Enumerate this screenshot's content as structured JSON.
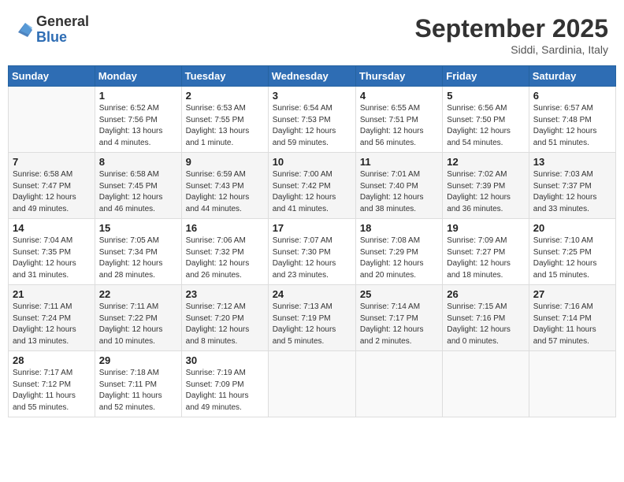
{
  "header": {
    "logo_general": "General",
    "logo_blue": "Blue",
    "month_title": "September 2025",
    "location": "Siddi, Sardinia, Italy"
  },
  "days_of_week": [
    "Sunday",
    "Monday",
    "Tuesday",
    "Wednesday",
    "Thursday",
    "Friday",
    "Saturday"
  ],
  "weeks": [
    [
      {
        "day": "",
        "info": ""
      },
      {
        "day": "1",
        "info": "Sunrise: 6:52 AM\nSunset: 7:56 PM\nDaylight: 13 hours\nand 4 minutes."
      },
      {
        "day": "2",
        "info": "Sunrise: 6:53 AM\nSunset: 7:55 PM\nDaylight: 13 hours\nand 1 minute."
      },
      {
        "day": "3",
        "info": "Sunrise: 6:54 AM\nSunset: 7:53 PM\nDaylight: 12 hours\nand 59 minutes."
      },
      {
        "day": "4",
        "info": "Sunrise: 6:55 AM\nSunset: 7:51 PM\nDaylight: 12 hours\nand 56 minutes."
      },
      {
        "day": "5",
        "info": "Sunrise: 6:56 AM\nSunset: 7:50 PM\nDaylight: 12 hours\nand 54 minutes."
      },
      {
        "day": "6",
        "info": "Sunrise: 6:57 AM\nSunset: 7:48 PM\nDaylight: 12 hours\nand 51 minutes."
      }
    ],
    [
      {
        "day": "7",
        "info": "Sunrise: 6:58 AM\nSunset: 7:47 PM\nDaylight: 12 hours\nand 49 minutes."
      },
      {
        "day": "8",
        "info": "Sunrise: 6:58 AM\nSunset: 7:45 PM\nDaylight: 12 hours\nand 46 minutes."
      },
      {
        "day": "9",
        "info": "Sunrise: 6:59 AM\nSunset: 7:43 PM\nDaylight: 12 hours\nand 44 minutes."
      },
      {
        "day": "10",
        "info": "Sunrise: 7:00 AM\nSunset: 7:42 PM\nDaylight: 12 hours\nand 41 minutes."
      },
      {
        "day": "11",
        "info": "Sunrise: 7:01 AM\nSunset: 7:40 PM\nDaylight: 12 hours\nand 38 minutes."
      },
      {
        "day": "12",
        "info": "Sunrise: 7:02 AM\nSunset: 7:39 PM\nDaylight: 12 hours\nand 36 minutes."
      },
      {
        "day": "13",
        "info": "Sunrise: 7:03 AM\nSunset: 7:37 PM\nDaylight: 12 hours\nand 33 minutes."
      }
    ],
    [
      {
        "day": "14",
        "info": "Sunrise: 7:04 AM\nSunset: 7:35 PM\nDaylight: 12 hours\nand 31 minutes."
      },
      {
        "day": "15",
        "info": "Sunrise: 7:05 AM\nSunset: 7:34 PM\nDaylight: 12 hours\nand 28 minutes."
      },
      {
        "day": "16",
        "info": "Sunrise: 7:06 AM\nSunset: 7:32 PM\nDaylight: 12 hours\nand 26 minutes."
      },
      {
        "day": "17",
        "info": "Sunrise: 7:07 AM\nSunset: 7:30 PM\nDaylight: 12 hours\nand 23 minutes."
      },
      {
        "day": "18",
        "info": "Sunrise: 7:08 AM\nSunset: 7:29 PM\nDaylight: 12 hours\nand 20 minutes."
      },
      {
        "day": "19",
        "info": "Sunrise: 7:09 AM\nSunset: 7:27 PM\nDaylight: 12 hours\nand 18 minutes."
      },
      {
        "day": "20",
        "info": "Sunrise: 7:10 AM\nSunset: 7:25 PM\nDaylight: 12 hours\nand 15 minutes."
      }
    ],
    [
      {
        "day": "21",
        "info": "Sunrise: 7:11 AM\nSunset: 7:24 PM\nDaylight: 12 hours\nand 13 minutes."
      },
      {
        "day": "22",
        "info": "Sunrise: 7:11 AM\nSunset: 7:22 PM\nDaylight: 12 hours\nand 10 minutes."
      },
      {
        "day": "23",
        "info": "Sunrise: 7:12 AM\nSunset: 7:20 PM\nDaylight: 12 hours\nand 8 minutes."
      },
      {
        "day": "24",
        "info": "Sunrise: 7:13 AM\nSunset: 7:19 PM\nDaylight: 12 hours\nand 5 minutes."
      },
      {
        "day": "25",
        "info": "Sunrise: 7:14 AM\nSunset: 7:17 PM\nDaylight: 12 hours\nand 2 minutes."
      },
      {
        "day": "26",
        "info": "Sunrise: 7:15 AM\nSunset: 7:16 PM\nDaylight: 12 hours\nand 0 minutes."
      },
      {
        "day": "27",
        "info": "Sunrise: 7:16 AM\nSunset: 7:14 PM\nDaylight: 11 hours\nand 57 minutes."
      }
    ],
    [
      {
        "day": "28",
        "info": "Sunrise: 7:17 AM\nSunset: 7:12 PM\nDaylight: 11 hours\nand 55 minutes."
      },
      {
        "day": "29",
        "info": "Sunrise: 7:18 AM\nSunset: 7:11 PM\nDaylight: 11 hours\nand 52 minutes."
      },
      {
        "day": "30",
        "info": "Sunrise: 7:19 AM\nSunset: 7:09 PM\nDaylight: 11 hours\nand 49 minutes."
      },
      {
        "day": "",
        "info": ""
      },
      {
        "day": "",
        "info": ""
      },
      {
        "day": "",
        "info": ""
      },
      {
        "day": "",
        "info": ""
      }
    ]
  ]
}
